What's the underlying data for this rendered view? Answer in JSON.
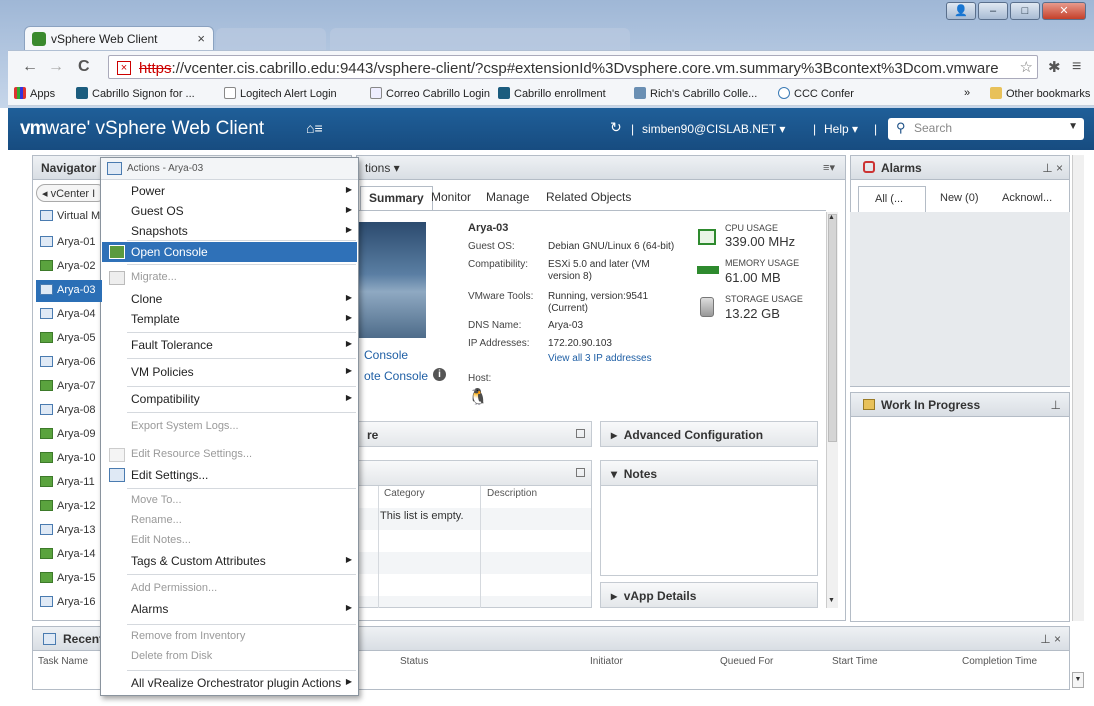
{
  "browser": {
    "tab_title": "vSphere Web Client",
    "url_proto": "https",
    "url_rest": "://vcenter.cis.cabrillo.edu:9443/vsphere-client/?csp#extensionId%3Dvsphere.core.vm.summary%3Bcontext%3Dcom.vmware",
    "bookmarks": [
      "Apps",
      "Cabrillo Signon for ...",
      "Logitech Alert Login",
      "Correo Cabrillo Login",
      "Cabrillo enrollment",
      "Rich's Cabrillo Colle...",
      "CCC Confer",
      "»",
      "Other bookmarks"
    ]
  },
  "header": {
    "logo_vm": "vm",
    "logo_rest": "ware' vSphere Web Client",
    "home": "⌂≡",
    "refresh": "↻",
    "sep": "|",
    "user": "simben90@CISLAB.NET ▾",
    "help": "Help ▾",
    "search_placeholder": "Search"
  },
  "navigator": {
    "title": "Navigator",
    "back_label": "◂ vCenter I",
    "virtual_label": "Virtual M",
    "vms": [
      "Arya-01",
      "Arya-02",
      "Arya-03",
      "Arya-04",
      "Arya-05",
      "Arya-06",
      "Arya-07",
      "Arya-08",
      "Arya-09",
      "Arya-10",
      "Arya-11",
      "Arya-12",
      "Arya-13",
      "Arya-14",
      "Arya-15",
      "Arya-16"
    ],
    "selected": "Arya-03"
  },
  "main": {
    "actions_fragment": "tions ▾",
    "tabs": [
      "Summary",
      "Monitor",
      "Manage",
      "Related Objects"
    ],
    "active_tab": "Summary",
    "console_link": "Console",
    "remote_console_link": "ote Console",
    "vm_name": "Arya-03",
    "guest_os_label": "Guest OS:",
    "guest_os_value": "Debian GNU/Linux 6 (64-bit)",
    "compat_label": "Compatibility:",
    "compat_value_1": "ESXi 5.0 and later (VM",
    "compat_value_2": "version 8)",
    "tools_label": "VMware Tools:",
    "tools_value_1": "Running, version:9541",
    "tools_value_2": "(Current)",
    "dns_label": "DNS Name:",
    "dns_value": "Arya-03",
    "ip_label": "IP Addresses:",
    "ip_value": "172.20.90.103",
    "ip_link": "View all 3 IP addresses",
    "host_label": "Host:",
    "cpu_label": "CPU USAGE",
    "cpu_value": "339.00 MHz",
    "mem_label": "MEMORY USAGE",
    "mem_value": "61.00 MB",
    "storage_label": "STORAGE USAGE",
    "storage_value": "13.22 GB",
    "hw_fragment": "re",
    "adv_config": "Advanced Configuration",
    "notes": "Notes",
    "vapp": "vApp Details",
    "col_category": "Category",
    "col_description": "Description",
    "empty_text": "This list is empty."
  },
  "alarms": {
    "title": "Alarms",
    "tabs": [
      "All (...",
      "New (0)",
      "Acknowl..."
    ]
  },
  "wip": {
    "title": "Work In Progress"
  },
  "recent": {
    "title": "Recent",
    "cols": [
      "Task Name",
      "Status",
      "Initiator",
      "Queued For",
      "Start Time",
      "Completion Time"
    ]
  },
  "menu": {
    "title": "Actions - Arya-03",
    "items": [
      {
        "label": "Power",
        "sub": true,
        "disabled": false
      },
      {
        "label": "Guest OS",
        "sub": true,
        "disabled": false
      },
      {
        "label": "Snapshots",
        "sub": true,
        "disabled": false
      },
      {
        "label": "Open Console",
        "sub": false,
        "disabled": false
      },
      {
        "label": "Migrate...",
        "sub": false,
        "disabled": true
      },
      {
        "label": "Clone",
        "sub": true,
        "disabled": false
      },
      {
        "label": "Template",
        "sub": true,
        "disabled": false
      },
      {
        "label": "Fault Tolerance",
        "sub": true,
        "disabled": false
      },
      {
        "label": "VM Policies",
        "sub": true,
        "disabled": false
      },
      {
        "label": "Compatibility",
        "sub": true,
        "disabled": false
      },
      {
        "label": "Export System Logs...",
        "sub": false,
        "disabled": true
      },
      {
        "label": "Edit Resource Settings...",
        "sub": false,
        "disabled": true
      },
      {
        "label": "Edit Settings...",
        "sub": false,
        "disabled": false
      },
      {
        "label": "Move To...",
        "sub": false,
        "disabled": true
      },
      {
        "label": "Rename...",
        "sub": false,
        "disabled": true
      },
      {
        "label": "Edit Notes...",
        "sub": false,
        "disabled": true
      },
      {
        "label": "Tags & Custom Attributes",
        "sub": true,
        "disabled": false
      },
      {
        "label": "Add Permission...",
        "sub": false,
        "disabled": true
      },
      {
        "label": "Alarms",
        "sub": true,
        "disabled": false
      },
      {
        "label": "Remove from Inventory",
        "sub": false,
        "disabled": true
      },
      {
        "label": "Delete from Disk",
        "sub": false,
        "disabled": true
      },
      {
        "label": "All vRealize Orchestrator plugin Actions",
        "sub": true,
        "disabled": false
      }
    ],
    "highlighted": "Open Console"
  },
  "colors": {
    "vmware_blue": "#1f5f99",
    "selection": "#2f71b8",
    "ok_green": "#2e8a2e"
  }
}
